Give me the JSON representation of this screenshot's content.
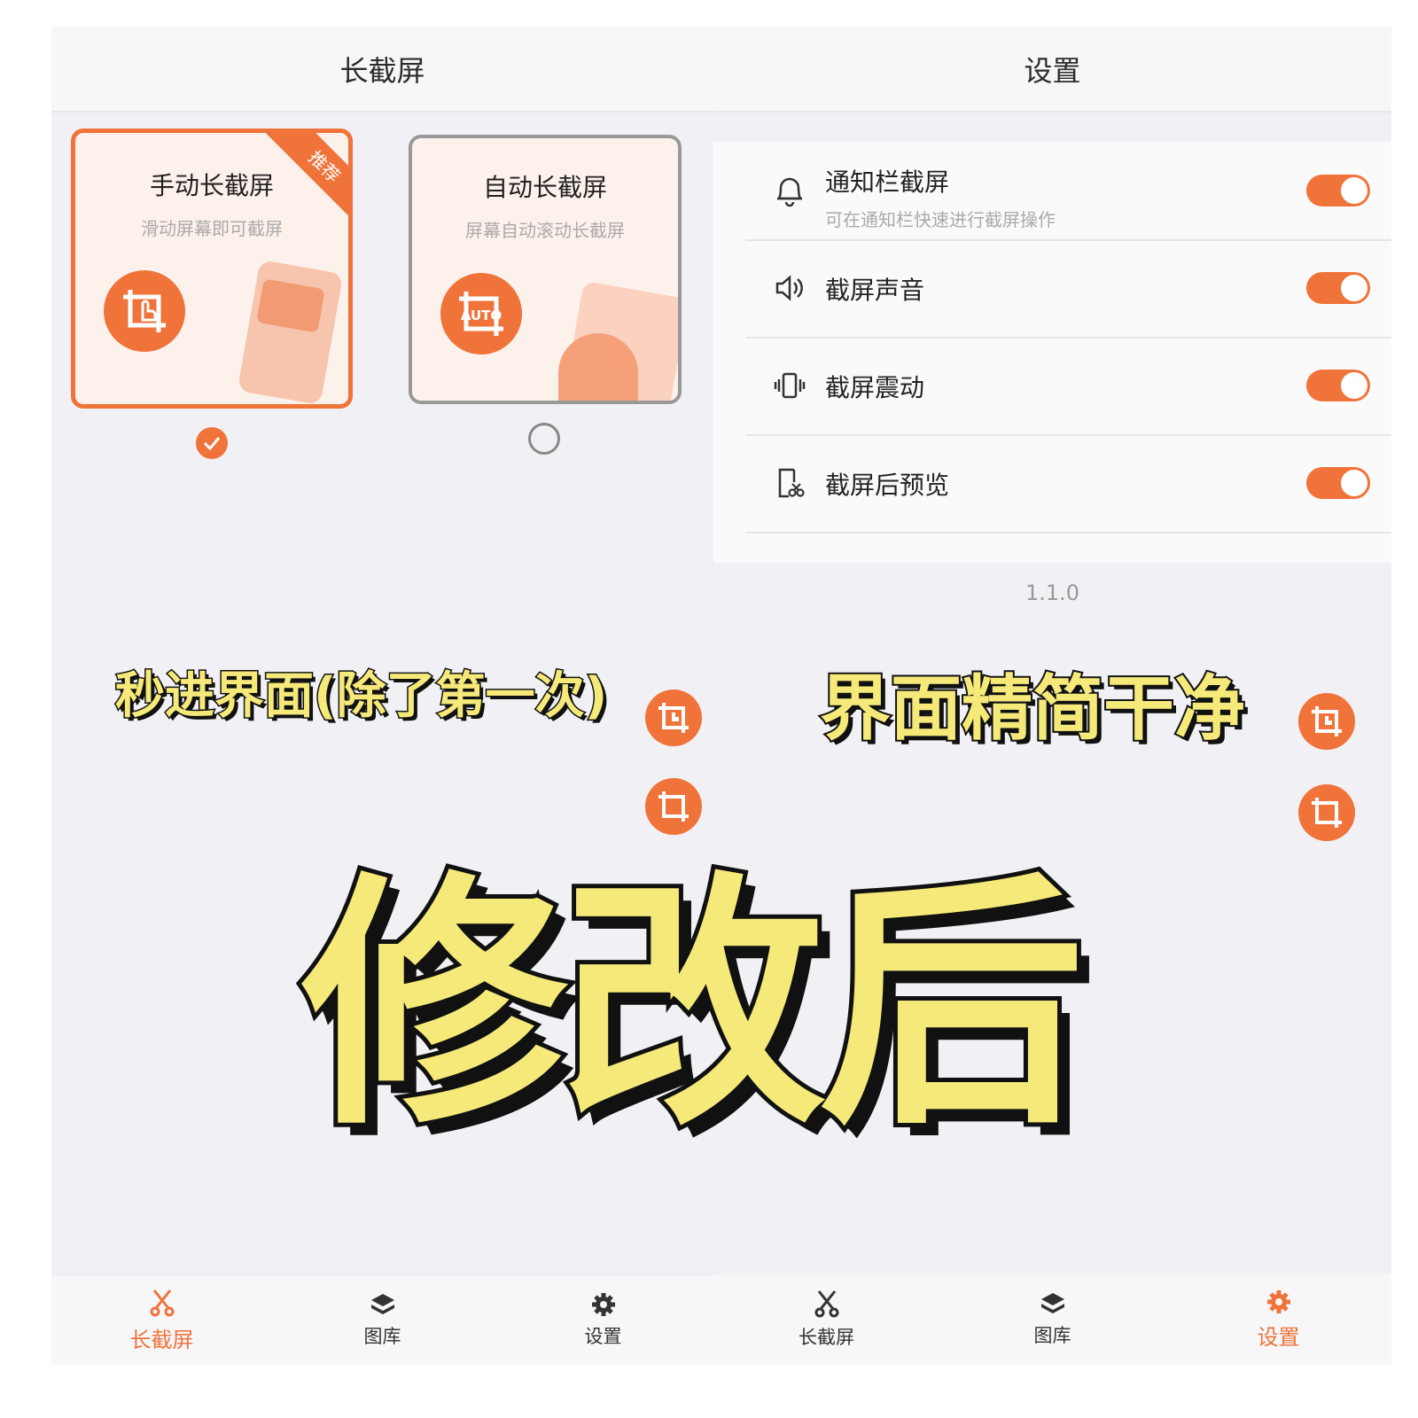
{
  "left": {
    "title": "长截屏",
    "cards": [
      {
        "title": "手动长截屏",
        "subtitle": "滑动屏幕即可截屏",
        "badge": "推荐",
        "icon": "crop-touch-icon",
        "selected": true
      },
      {
        "title": "自动长截屏",
        "subtitle": "屏幕自动滚动长截屏",
        "icon": "crop-auto-icon",
        "icon_text": "AUTO",
        "selected": false
      }
    ],
    "nav": [
      {
        "label": "长截屏",
        "icon": "scissors-icon",
        "active": true
      },
      {
        "label": "图库",
        "icon": "layers-icon",
        "active": false
      },
      {
        "label": "设置",
        "icon": "gear-icon",
        "active": false
      }
    ]
  },
  "right": {
    "title": "设置",
    "settings": [
      {
        "title": "通知栏截屏",
        "subtitle": "可在通知栏快速进行截屏操作",
        "icon": "bell-icon",
        "on": true
      },
      {
        "title": "截屏声音",
        "icon": "speaker-icon",
        "on": true
      },
      {
        "title": "截屏震动",
        "icon": "vibrate-icon",
        "on": true
      },
      {
        "title": "截屏后预览",
        "icon": "preview-icon",
        "on": true
      }
    ],
    "version": "1.1.0",
    "nav": [
      {
        "label": "长截屏",
        "icon": "scissors-icon",
        "active": false
      },
      {
        "label": "图库",
        "icon": "layers-icon",
        "active": false
      },
      {
        "label": "设置",
        "icon": "gear-icon",
        "active": true
      }
    ]
  },
  "captions": {
    "left": "秒进界面(除了第一次)",
    "right": "界面精简干净",
    "big": "修改后"
  },
  "colors": {
    "accent": "#f0733a",
    "caption_fill": "#f5e97a",
    "background": "#f1f1f5"
  }
}
